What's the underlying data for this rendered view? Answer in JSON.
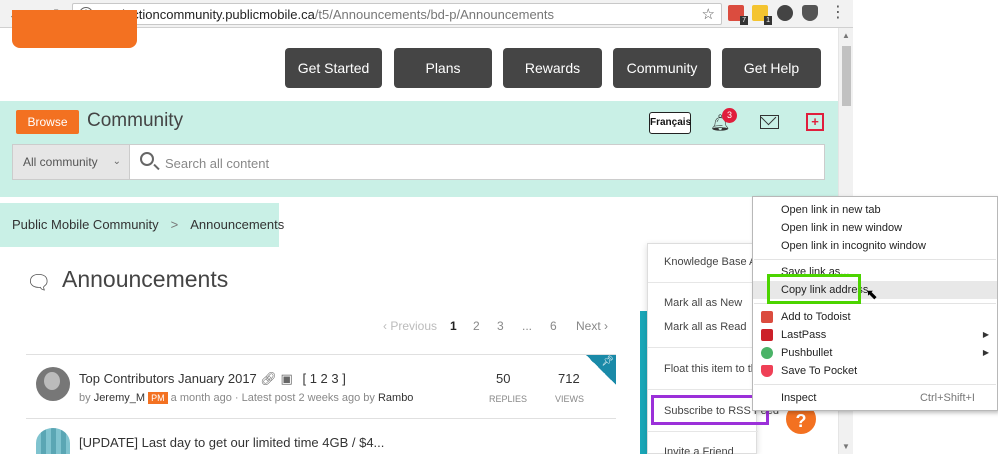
{
  "browser": {
    "url_host": "productioncommunity.publicmobile.ca",
    "url_path": "/t5/Announcements/bd-p/Announcements",
    "extension_badges": [
      "7",
      "1"
    ]
  },
  "main_nav": [
    "Get Started",
    "Plans",
    "Rewards",
    "Community",
    "Get Help"
  ],
  "community_bar": {
    "browse_label": "Browse",
    "title": "Community",
    "language_label": "Français",
    "notification_count": "3"
  },
  "search": {
    "scope": "All community",
    "placeholder": "Search all content"
  },
  "breadcrumb": {
    "items": [
      "Public Mobile Community",
      "Announcements"
    ],
    "separator": ">"
  },
  "board": {
    "title": "Announcements"
  },
  "pagination": {
    "previous": "‹ Previous",
    "pages": [
      "1",
      "2",
      "3",
      "...",
      "6"
    ],
    "next": "Next ›"
  },
  "topics": [
    {
      "title": "Top Contributors January 2017",
      "pages": "[ 1 2 3 ]",
      "by_prefix": "by",
      "author": "Jeremy_M",
      "author_badge": "PM",
      "posted": "a month ago",
      "latest_prefix": "· Latest post 2 weeks ago by",
      "latest_author": "Rambo",
      "replies": "50",
      "replies_label": "REPLIES",
      "views": "712",
      "views_label": "VIEWS"
    },
    {
      "title": "[UPDATE] Last day to get our limited time 4GB / $4..."
    }
  ],
  "options_menu": {
    "items": [
      "Knowledge Base Art",
      "Mark all as New",
      "Mark all as Read",
      "Float this item to th",
      "Subscribe to RSS Feed",
      "Invite a Friend"
    ]
  },
  "help_bubble": "?",
  "context_menu": {
    "items": [
      {
        "label": "Open link in new tab"
      },
      {
        "label": "Open link in new window"
      },
      {
        "label": "Open link in incognito window"
      },
      {
        "label": "Save link as..."
      },
      {
        "label": "Copy link address"
      },
      {
        "label": "Add to Todoist"
      },
      {
        "label": "LastPass"
      },
      {
        "label": "Pushbullet"
      },
      {
        "label": "Save To Pocket"
      },
      {
        "label": "Inspect",
        "shortcut": "Ctrl+Shift+I"
      }
    ]
  },
  "colors": {
    "brand_orange": "#f37121",
    "mint": "#c9f0e6",
    "nav_dark": "#454545",
    "highlight_green": "#4cd400",
    "highlight_purple": "#9b30d9"
  }
}
